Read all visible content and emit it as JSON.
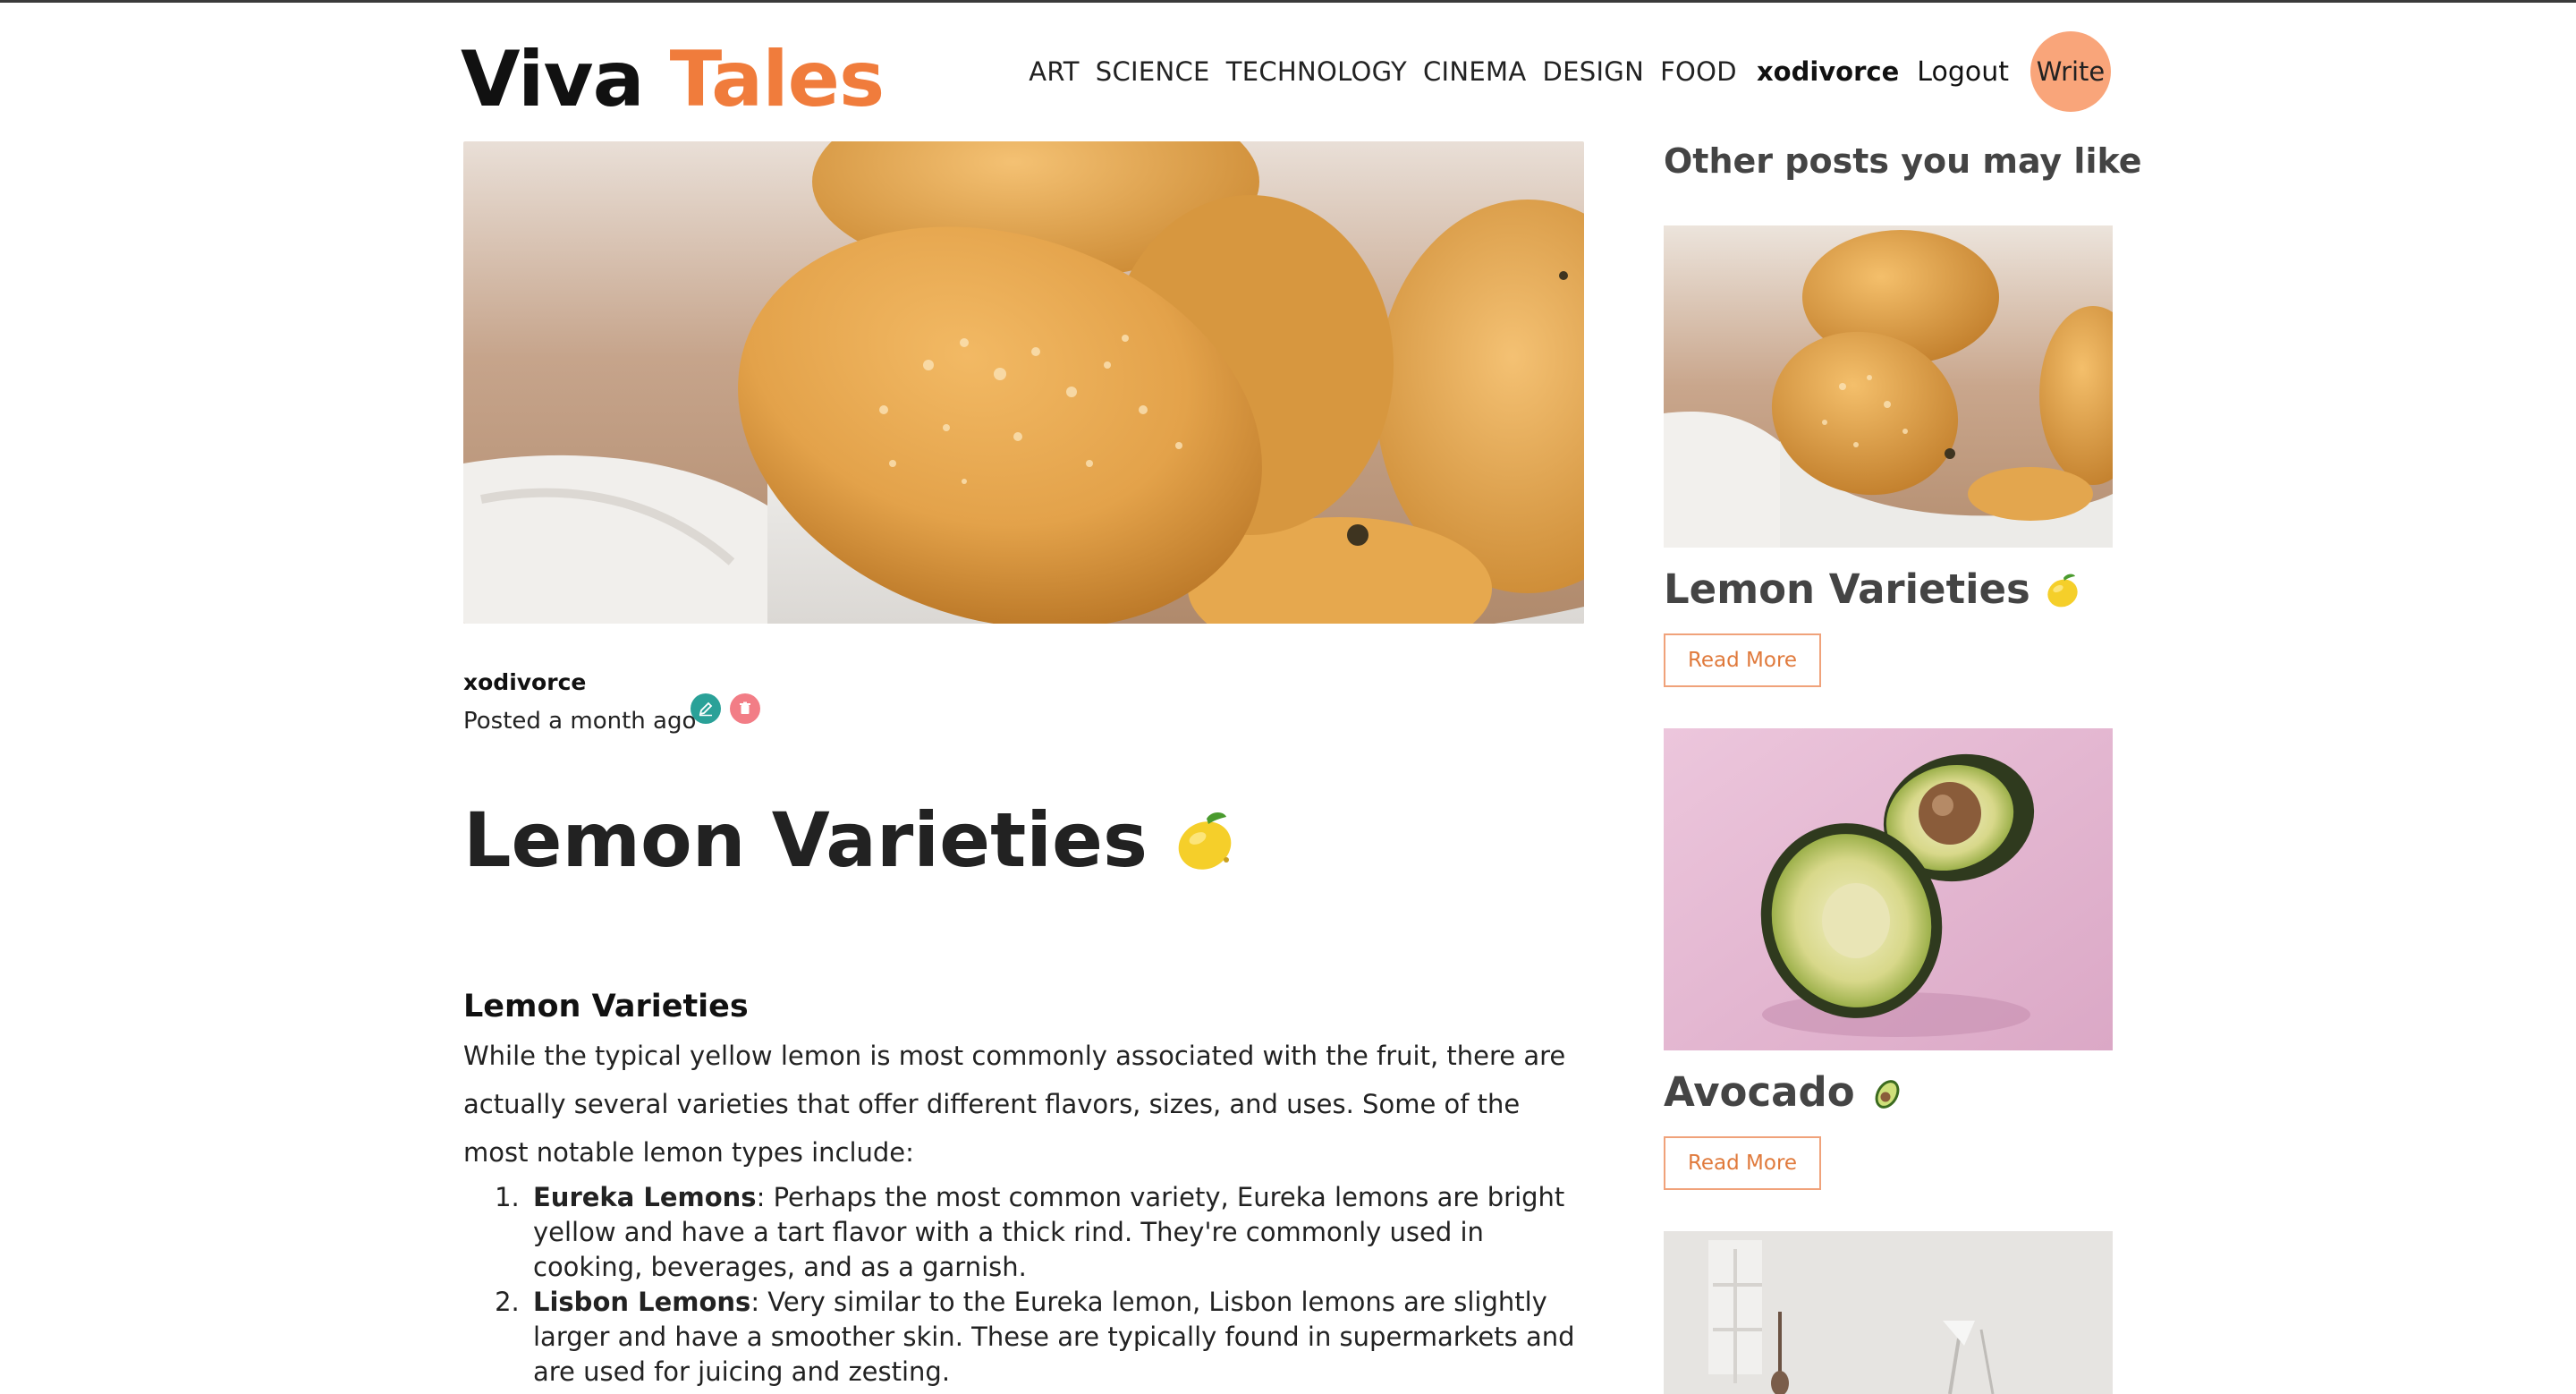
{
  "brand": {
    "part1": "Viva",
    "part2": "Tales"
  },
  "nav": {
    "categories": [
      "ART",
      "SCIENCE",
      "TECHNOLOGY",
      "CINEMA",
      "DESIGN",
      "FOOD"
    ],
    "username": "xodivorce",
    "logout": "Logout",
    "write": "Write"
  },
  "post": {
    "author": "xodivorce",
    "posted": "Posted a month ago",
    "title": "Lemon Varieties",
    "section_heading": "Lemon Varieties",
    "intro": "While the typical yellow lemon is most commonly associated with the fruit, there are actually several varieties that offer different flavors, sizes, and uses. Some of the most notable lemon types include:",
    "list": [
      {
        "name": "Eureka Lemons",
        "text": ": Perhaps the most common variety, Eureka lemons are bright yellow and have a tart flavor with a thick rind. They're commonly used in cooking, beverages, and as a garnish."
      },
      {
        "name": "Lisbon Lemons",
        "text": ": Very similar to the Eureka lemon, Lisbon lemons are slightly larger and have a smoother skin. These are typically found in supermarkets and are used for juicing and zesting."
      }
    ]
  },
  "sidebar": {
    "heading": "Other posts you may like",
    "cards": [
      {
        "title": "Lemon Varieties",
        "read_more": "Read More",
        "emoji": "lemon-icon"
      },
      {
        "title": "Avocado",
        "read_more": "Read More",
        "emoji": "avocado-icon"
      }
    ]
  },
  "colors": {
    "accent": "#f07c3c",
    "write_bg": "#f9a57a",
    "edit": "#2aa198",
    "delete": "#f27d86",
    "avocado_bg": "#e8bcd6"
  }
}
